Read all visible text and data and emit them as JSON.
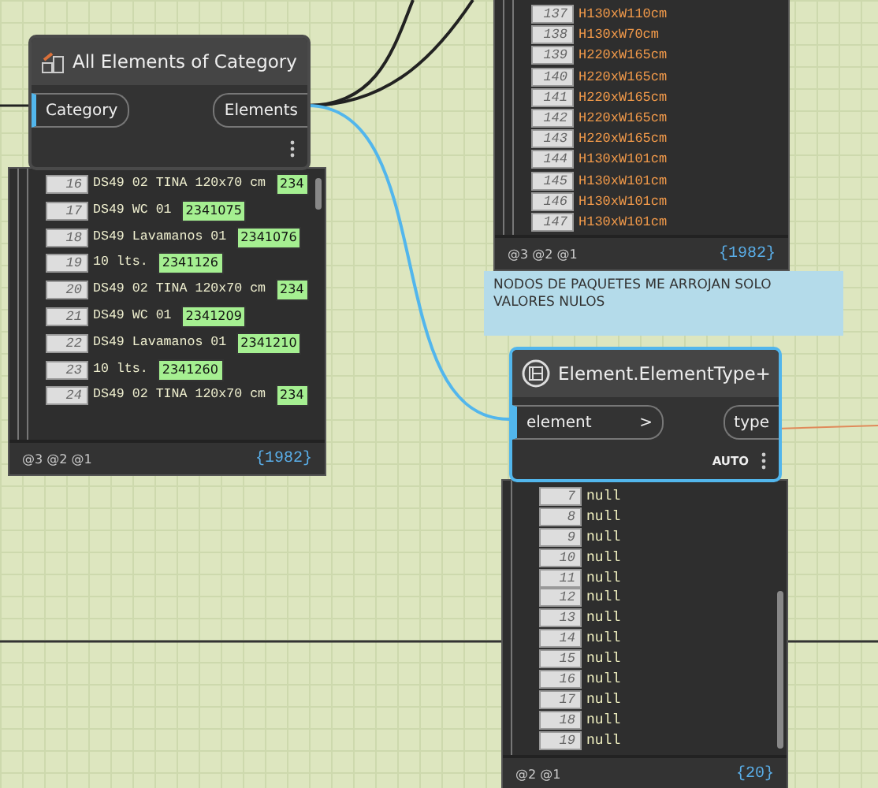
{
  "category_node": {
    "title": "All Elements of Category",
    "input": "Category",
    "output": "Elements",
    "selected": false
  },
  "category_preview": {
    "rows": [
      {
        "index": "16",
        "text": "DS49 02 TINA 120x70 cm",
        "id": "234"
      },
      {
        "index": "17",
        "text": "DS49 WC 01",
        "id": "2341075"
      },
      {
        "index": "18",
        "text": "DS49 Lavamanos 01",
        "id": "2341076"
      },
      {
        "index": "19",
        "text": "10 lts.",
        "id": "2341126"
      },
      {
        "index": "20",
        "text": "DS49 02 TINA 120x70 cm",
        "id": "234"
      },
      {
        "index": "21",
        "text": "DS49 WC 01",
        "id": "2341209"
      },
      {
        "index": "22",
        "text": "DS49 Lavamanos 01",
        "id": "2341210"
      },
      {
        "index": "23",
        "text": "10 lts.",
        "id": "2341260"
      },
      {
        "index": "24",
        "text": "DS49 02 TINA 120x70 cm",
        "id": "234"
      }
    ],
    "levels": [
      "@3",
      "@2",
      "@1"
    ],
    "count": "{1982}"
  },
  "type_preview": {
    "rows": [
      {
        "index": "137",
        "text": "H130xW110cm"
      },
      {
        "index": "138",
        "text": "H130xW70cm"
      },
      {
        "index": "139",
        "text": "H220xW165cm"
      },
      {
        "index": "140",
        "text": "H220xW165cm"
      },
      {
        "index": "141",
        "text": "H220xW165cm"
      },
      {
        "index": "142",
        "text": "H220xW165cm"
      },
      {
        "index": "143",
        "text": "H220xW165cm"
      },
      {
        "index": "144",
        "text": "H130xW101cm"
      },
      {
        "index": "145",
        "text": "H130xW101cm"
      },
      {
        "index": "146",
        "text": "H130xW101cm"
      },
      {
        "index": "147",
        "text": "H130xW101cm"
      }
    ],
    "levels": [
      "@3",
      "@2",
      "@1"
    ],
    "count": "{1982}"
  },
  "note": {
    "text": "NODOS DE PAQUETES ME ARROJAN SOLO VALORES NULOS"
  },
  "type_node": {
    "title": "Element.ElementType+",
    "input": "element",
    "input_arrow": ">",
    "output": "type",
    "lacing": "AUTO",
    "selected": true
  },
  "null_preview": {
    "rows": [
      {
        "index": "7",
        "text": "null"
      },
      {
        "index": "8",
        "text": "null"
      },
      {
        "index": "9",
        "text": "null"
      },
      {
        "index": "10",
        "text": "null"
      },
      {
        "index": "11",
        "text": "null"
      },
      {
        "index": "12",
        "text": "null"
      },
      {
        "index": "13",
        "text": "null"
      },
      {
        "index": "14",
        "text": "null"
      },
      {
        "index": "15",
        "text": "null"
      },
      {
        "index": "16",
        "text": "null"
      },
      {
        "index": "17",
        "text": "null"
      },
      {
        "index": "18",
        "text": "null"
      },
      {
        "index": "19",
        "text": "null"
      }
    ],
    "levels": [
      "@2",
      "@1"
    ],
    "count": "{20}"
  }
}
